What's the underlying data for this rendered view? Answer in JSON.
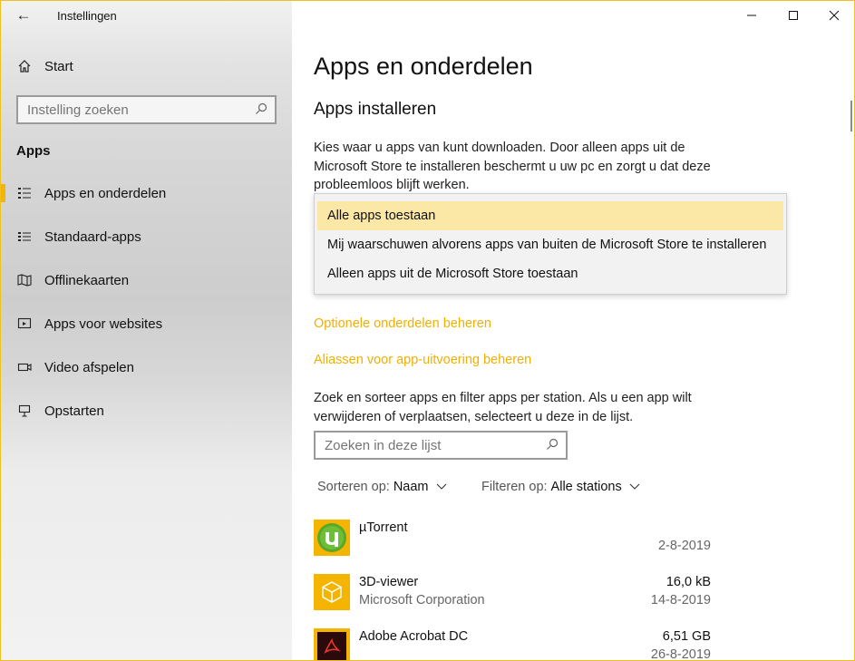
{
  "window": {
    "app_title": "Instellingen",
    "back_label": "←",
    "controls": {
      "minimize": "–",
      "maximize": "☐",
      "close": "✕"
    }
  },
  "sidebar": {
    "home_label": "Start",
    "search_placeholder": "Instelling zoeken",
    "section_title": "Apps",
    "items": [
      {
        "label": "Apps en onderdelen",
        "icon": "apps-features-icon",
        "active": true
      },
      {
        "label": "Standaard-apps",
        "icon": "default-apps-icon",
        "active": false
      },
      {
        "label": "Offlinekaarten",
        "icon": "map-icon",
        "active": false
      },
      {
        "label": "Apps voor websites",
        "icon": "web-apps-icon",
        "active": false
      },
      {
        "label": "Video afspelen",
        "icon": "video-icon",
        "active": false
      },
      {
        "label": "Opstarten",
        "icon": "startup-icon",
        "active": false
      }
    ]
  },
  "main": {
    "title": "Apps en onderdelen",
    "install_section_title": "Apps installeren",
    "install_description": "Kies waar u apps van kunt downloaden. Door alleen apps uit de Microsoft Store te installeren beschermt u uw pc en zorgt u dat deze probleemloos blijft werken.",
    "dropdown_options": [
      {
        "label": "Alle apps toestaan",
        "selected": true
      },
      {
        "label": "Mij waarschuwen alvorens apps van buiten de Microsoft Store te installeren",
        "selected": false
      },
      {
        "label": "Alleen apps uit de Microsoft Store toestaan",
        "selected": false
      }
    ],
    "link_optional": "Optionele onderdelen beheren",
    "link_aliases": "Aliassen voor app-uitvoering beheren",
    "list_description": "Zoek en sorteer apps en filter apps per station. Als u een app wilt verwijderen of verplaatsen, selecteert u deze in de lijst.",
    "list_search_placeholder": "Zoeken in deze lijst",
    "sort_label": "Sorteren op:",
    "sort_value": "Naam",
    "filter_label": "Filteren op:",
    "filter_value": "Alle stations",
    "apps": [
      {
        "name": "µTorrent",
        "publisher": "",
        "size": "",
        "date": "2-8-2019",
        "icon": "utorrent-icon"
      },
      {
        "name": "3D-viewer",
        "publisher": "Microsoft Corporation",
        "size": "16,0 kB",
        "date": "14-8-2019",
        "icon": "3d-viewer-icon"
      },
      {
        "name": "Adobe Acrobat DC",
        "publisher": "",
        "size": "6,51 GB",
        "date": "26-8-2019",
        "icon": "adobe-acrobat-icon"
      }
    ]
  },
  "colors": {
    "accent": "#f0b000",
    "accent_bar": "#f5b400",
    "selected_option": "#fce8a6",
    "window_border": "#f0c020"
  }
}
